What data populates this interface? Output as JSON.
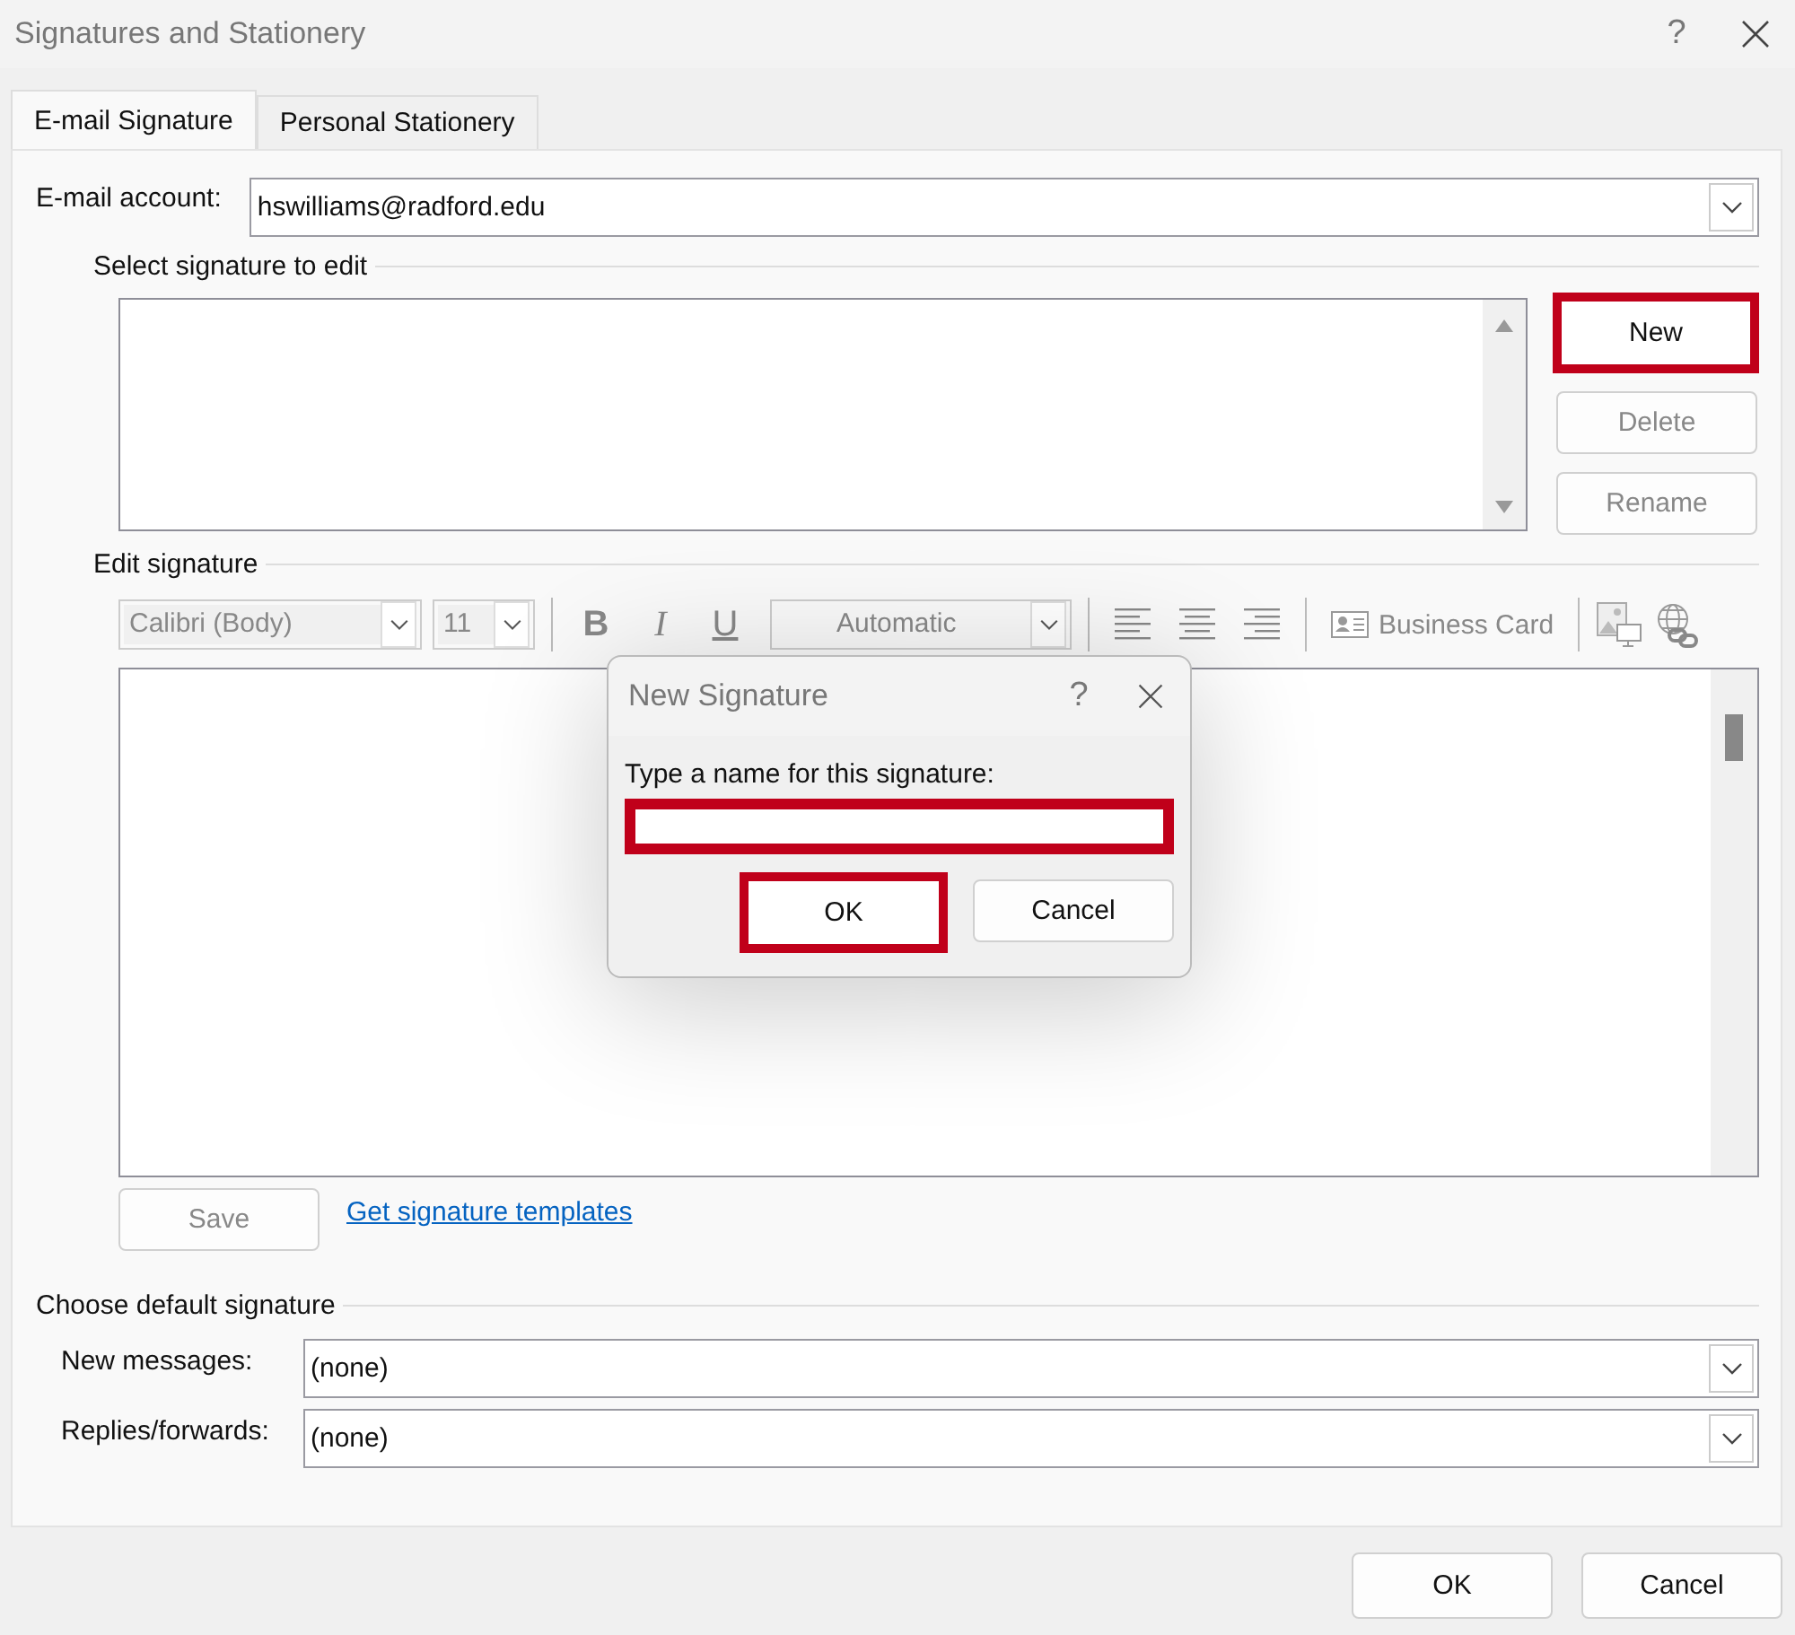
{
  "window": {
    "title": "Signatures and Stationery",
    "help": "?"
  },
  "tabs": [
    {
      "label": "E-mail Signature",
      "selected": true
    },
    {
      "label": "Personal Stationery",
      "selected": false
    }
  ],
  "email_account": {
    "label": "E-mail account:",
    "value": "hswilliams@radford.edu"
  },
  "select_signature": {
    "heading": "Select signature to edit",
    "buttons": [
      {
        "label": "New",
        "highlighted": true,
        "disabled": false
      },
      {
        "label": "Delete",
        "highlighted": false,
        "disabled": true
      },
      {
        "label": "Rename",
        "highlighted": false,
        "disabled": true
      }
    ]
  },
  "edit_signature": {
    "heading": "Edit signature",
    "toolbar": {
      "disabled": true,
      "font": "Calibri (Body)",
      "size": "11",
      "styles": [
        "B",
        "I",
        "U"
      ],
      "color_name": "Automatic",
      "business_card": "Business Card"
    },
    "save_button": {
      "label": "Save",
      "disabled": true
    },
    "templates_link": "Get signature templates"
  },
  "default_signature": {
    "heading": "Choose default signature",
    "fields": [
      {
        "label": "New messages:",
        "value": "(none)"
      },
      {
        "label": "Replies/forwards:",
        "value": "(none)"
      }
    ]
  },
  "buttons": [
    {
      "label": "OK"
    },
    {
      "label": "Cancel"
    }
  ],
  "dialog": {
    "title": "New Signature",
    "help": "?",
    "prompt": "Type a name for this signature:",
    "name_field": {
      "highlighted": true
    },
    "buttons": [
      {
        "label": "OK",
        "highlighted": true
      },
      {
        "label": "Cancel",
        "highlighted": false
      }
    ]
  }
}
